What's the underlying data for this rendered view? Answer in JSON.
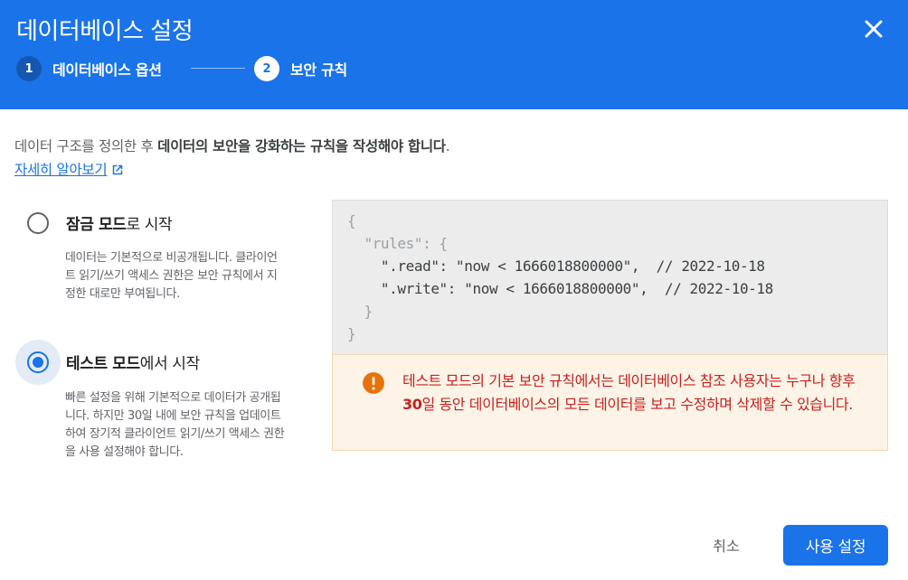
{
  "dialog": {
    "title": "데이터베이스 설정",
    "close_icon": "close-icon"
  },
  "stepper": {
    "steps": [
      {
        "number": "1",
        "label": "데이터베이스 옵션",
        "state": "completed"
      },
      {
        "number": "2",
        "label": "보안 규칙",
        "state": "active"
      }
    ]
  },
  "intro": {
    "text_prefix": "데이터 구조를 정의한 후 ",
    "text_bold": "데이터의 보안을 강화하는 규칙을 작성해야 합니다",
    "text_suffix": ".",
    "learn_more": "자세히 알아보기",
    "learn_more_icon": "open-in-new-icon"
  },
  "options": [
    {
      "title_bold": "잠금 모드",
      "title_rest": "로 시작",
      "description": "데이터는 기본적으로 비공개됩니다. 클라이언트 읽기/쓰기 액세스 권한은 보안 규칙에서 지정한 대로만 부여됩니다.",
      "selected": false
    },
    {
      "title_bold": "테스트 모드",
      "title_rest": "에서 시작",
      "description": "빠른 설정을 위해 기본적으로 데이터가 공개됩니다. 하지만 30일 내에 보안 규칙을 업데이트하여 장기적 클라이언트 읽기/쓰기 액세스 권한을 사용 설정해야 합니다.",
      "selected": true
    }
  ],
  "rules_code": {
    "line1": "{",
    "line2": "  \"rules\": {",
    "line3": "    \".read\": \"now < 1666018800000\",  // 2022-10-18",
    "line4": "    \".write\": \"now < 1666018800000\",  // 2022-10-18",
    "line5": "  }",
    "line6": "}"
  },
  "warning": {
    "icon": "error-icon",
    "text_prefix": "테스트 모드의 기본 보안 규칙에서는 데이터베이스 참조 사용자는 누구나 향후 ",
    "text_bold": "30",
    "text_suffix": "일 동안 데이터베이스의 모든 데이터를 보고 수정하며 삭제할 수 있습니다."
  },
  "actions": {
    "cancel": "취소",
    "enable": "사용 설정"
  },
  "colors": {
    "primary": "#1a73e8",
    "warning_text": "#c5221f",
    "warning_icon": "#e8710a"
  }
}
